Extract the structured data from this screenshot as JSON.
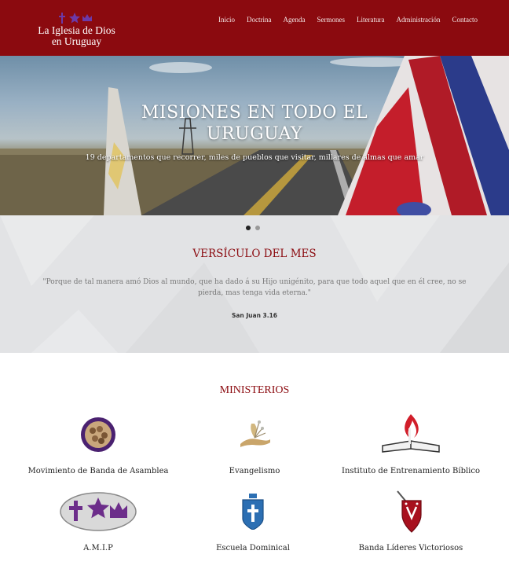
{
  "header": {
    "logo_line1": "La Iglesia de Dios",
    "logo_line2": "en Uruguay",
    "logo_icons": [
      "cross-icon",
      "star-icon",
      "crown-icon"
    ],
    "nav": [
      "Inicio",
      "Doctrina",
      "Agenda",
      "Sermones",
      "Literatura",
      "Administración",
      "Contacto"
    ]
  },
  "hero": {
    "title_line1": "MISIONES EN TODO EL",
    "title_line2": "URUGUAY",
    "subtitle": "19 departamentos que recorrer, miles de pueblos que visitar, millares de almas que amar",
    "slides": 2,
    "active_slide": 1
  },
  "verse": {
    "title": "VERSÍCULO DEL MES",
    "text": "\"Porque de tal manera amó Dios al mundo, que ha dado á su Hijo unigénito, para que todo aquel que en él cree, no se pierda, mas tenga vida eterna.\"",
    "reference": "San Juan 3.16"
  },
  "ministries": {
    "title": "MINISTERIOS",
    "items": [
      {
        "label": "Movimiento de Banda de Asamblea",
        "icon": "group-circle-icon"
      },
      {
        "label": "Evangelismo",
        "icon": "seed-hand-icon"
      },
      {
        "label": "Instituto de Entrenamiento Bíblico",
        "icon": "flame-bible-icon"
      },
      {
        "label": "A.M.I.P",
        "icon": "cross-star-crown-icon"
      },
      {
        "label": "Escuela Dominical",
        "icon": "shield-cross-icon"
      },
      {
        "label": "Banda Líderes Victoriosos",
        "icon": "shield-sword-icon"
      }
    ]
  },
  "colors": {
    "brand": "#8b0a0f",
    "logo_icons": "#5b2a86"
  }
}
